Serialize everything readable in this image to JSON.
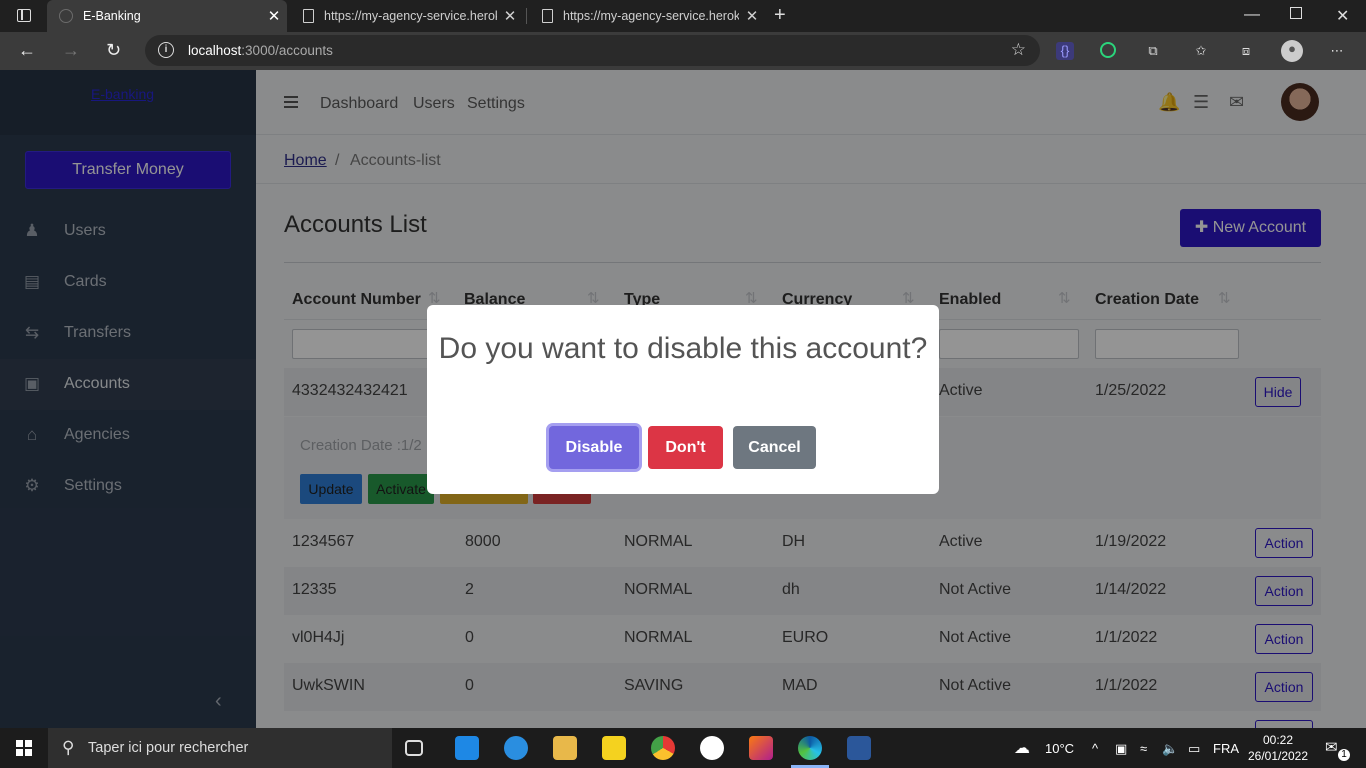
{
  "browser": {
    "tabs": [
      {
        "title": "E-Banking"
      },
      {
        "title": "https://my-agency-service.herok"
      },
      {
        "title": "https://my-agency-service.herok"
      }
    ],
    "url_host": "localhost",
    "url_path": ":3000/accounts"
  },
  "sidebar": {
    "brand": "E-banking",
    "transfer_button": "Transfer Money",
    "items": [
      {
        "label": "Users",
        "icon": "users-icon"
      },
      {
        "label": "Cards",
        "icon": "card-icon"
      },
      {
        "label": "Transfers",
        "icon": "transfer-arrows-icon"
      },
      {
        "label": "Accounts",
        "icon": "bank-notes-icon",
        "active": true
      },
      {
        "label": "Agencies",
        "icon": "bank-building-icon"
      },
      {
        "label": "Settings",
        "icon": "gear-icon"
      }
    ]
  },
  "topnav": {
    "links": [
      "Dashboard",
      "Users",
      "Settings"
    ]
  },
  "breadcrumb": {
    "home": "Home",
    "separator": "/",
    "current": "Accounts-list"
  },
  "page": {
    "title": "Accounts List",
    "new_button": "New Account"
  },
  "table": {
    "headers": [
      "Account Number",
      "Balance",
      "Type",
      "Currency",
      "Enabled",
      "Creation Date"
    ],
    "rows": [
      {
        "number": "4332432432421",
        "balance": "",
        "type": "",
        "currency": "",
        "enabled": "Active",
        "date": "1/25/2022",
        "action": "Hide"
      },
      {
        "number": "1234567",
        "balance": "8000",
        "type": "NORMAL",
        "currency": "DH",
        "enabled": "Active",
        "date": "1/19/2022",
        "action": "Action"
      },
      {
        "number": "12335",
        "balance": "2",
        "type": "NORMAL",
        "currency": "dh",
        "enabled": "Not Active",
        "date": "1/14/2022",
        "action": "Action"
      },
      {
        "number": "vl0H4Jj",
        "balance": "0",
        "type": "NORMAL",
        "currency": "EURO",
        "enabled": "Not Active",
        "date": "1/1/2022",
        "action": "Action"
      },
      {
        "number": "UwkSWIN",
        "balance": "0",
        "type": "SAVING",
        "currency": "MAD",
        "enabled": "Not Active",
        "date": "1/1/2022",
        "action": "Action"
      }
    ],
    "detail": {
      "label": "Creation Date :1/2",
      "buttons": [
        "Update",
        "Activate"
      ]
    }
  },
  "modal": {
    "title": "Do you want to disable this account?",
    "buttons": {
      "confirm": "Disable",
      "deny": "Don't",
      "cancel": "Cancel"
    }
  },
  "taskbar": {
    "search_placeholder": "Taper ici pour rechercher",
    "weather": "10°C",
    "language": "FRA",
    "time": "00:22",
    "date": "26/01/2022",
    "notifications": "1"
  },
  "colors": {
    "primary": "#2d17c7",
    "sidebar": "#2c3b4f",
    "danger": "#dc3545",
    "modal_confirm": "#7267dd"
  }
}
